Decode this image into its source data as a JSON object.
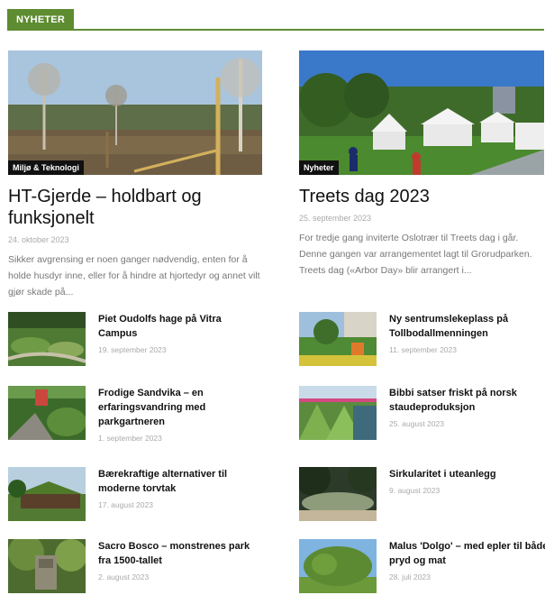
{
  "section": {
    "label": "NYHETER"
  },
  "features": [
    {
      "category": "Miljø & Teknologi",
      "title": "HT-Gjerde – holdbart og funksjonelt",
      "date": "24. oktober 2023",
      "excerpt": "Sikker avgrensing er noen ganger nødvendig, enten for å holde husdyr inne, eller for å hindre at hjortedyr og annet vilt gjør skade på..."
    },
    {
      "category": "Nyheter",
      "title": "Treets dag 2023",
      "date": "25. september 2023",
      "excerpt": "For tredje gang inviterte Oslotrær til Treets dag i går. Denne gangen var arrangementet lagt til Grorudparken. Treets dag («Arbor Day» blir arrangert i..."
    }
  ],
  "list_left": [
    {
      "title": "Piet Oudolfs hage på Vitra Campus",
      "date": "19. september 2023"
    },
    {
      "title": "Frodige Sandvika – en erfaringsvandring med parkgartneren",
      "date": "1. september 2023"
    },
    {
      "title": "Bærekraftige alternativer til moderne torvtak",
      "date": "17. august 2023"
    },
    {
      "title": "Sacro Bosco – monstrenes park fra 1500-tallet",
      "date": "2. august 2023"
    }
  ],
  "list_right": [
    {
      "title": "Ny sentrumslekeplass på Tollbodallmenningen",
      "date": "11. september 2023"
    },
    {
      "title": "Bibbi satser friskt på norsk staudeproduksjon",
      "date": "25. august 2023"
    },
    {
      "title": "Sirkularitet i uteanlegg",
      "date": "9. august 2023"
    },
    {
      "title": "Malus 'Dolgo' – med epler til både pryd og mat",
      "date": "28. juli 2023"
    }
  ],
  "colors": {
    "accent": "#5e8c31",
    "badge_bg": "#111111"
  }
}
